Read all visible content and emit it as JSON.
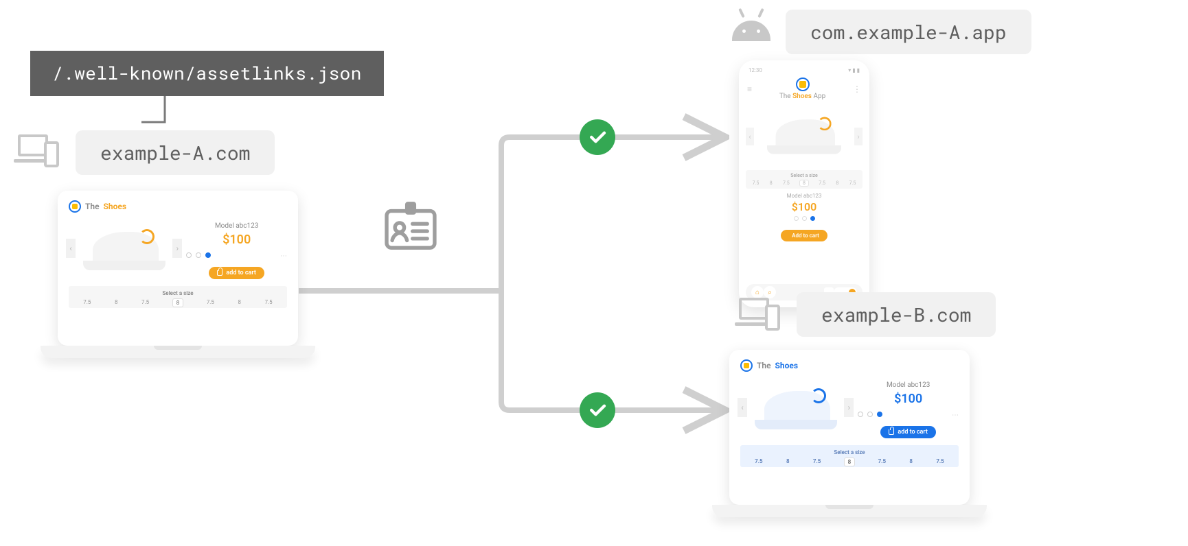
{
  "labels": {
    "assetlinks_path": "/.well-known/assetlinks.json",
    "site_a": "example-A.com",
    "site_b": "example-B.com",
    "app_package": "com.example-A.app"
  },
  "shop_orange": {
    "brand_the": "The",
    "brand_name": "Shoes",
    "model": "Model abc123",
    "price": "$100",
    "cart": "add to cart",
    "size_title": "Select a size",
    "sizes": [
      "7.5",
      "8",
      "7.5",
      "8",
      "7.5",
      "8",
      "7.5"
    ]
  },
  "shop_blue": {
    "brand_the": "The",
    "brand_name": "Shoes",
    "model": "Model abc123",
    "price": "$100",
    "cart": "add to cart",
    "size_title": "Select a size",
    "sizes": [
      "7.5",
      "8",
      "7.5",
      "8",
      "7.5",
      "8",
      "7.5"
    ]
  },
  "phone": {
    "time": "12:30",
    "title_the": "The",
    "title_accent": "Shoes",
    "title_app": "App",
    "model": "Model abc123",
    "price": "$100",
    "cart": "Add to cart",
    "size_title": "Select a size",
    "sizes": [
      "7.5",
      "8",
      "7.5",
      "8",
      "7.5",
      "8",
      "7.5"
    ]
  }
}
